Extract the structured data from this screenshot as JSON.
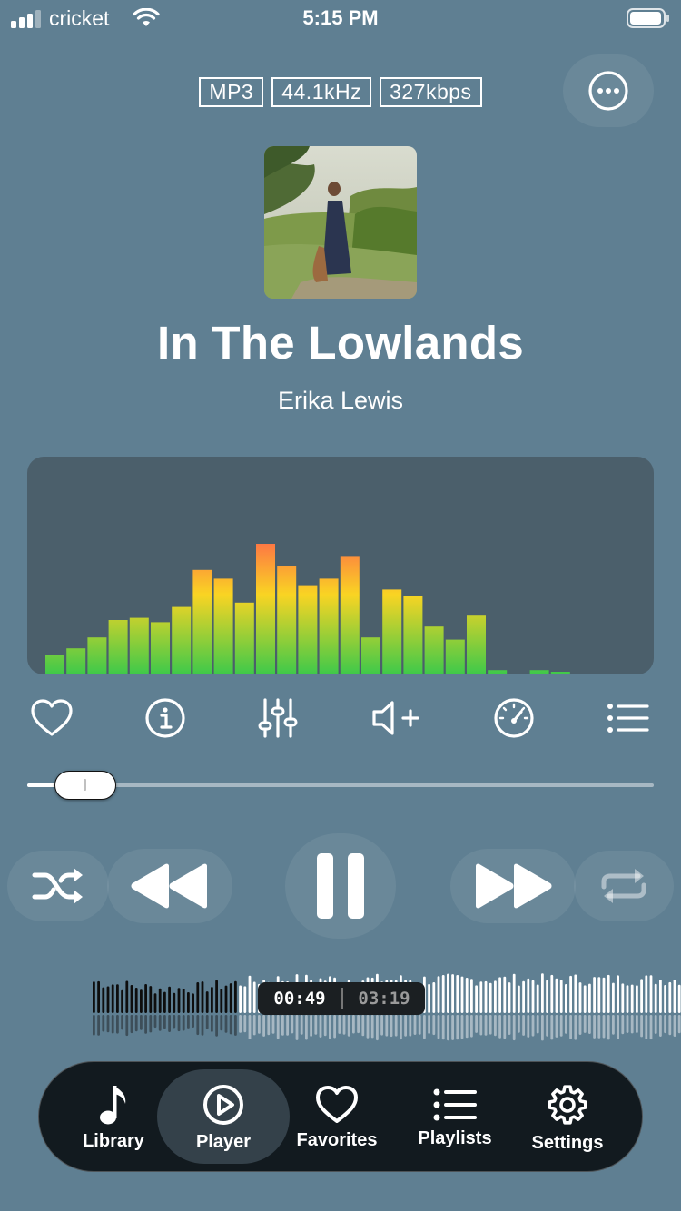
{
  "status_bar": {
    "carrier": "cricket",
    "time": "5:15 PM"
  },
  "format": {
    "codec": "MP3",
    "sample_rate": "44.1kHz",
    "bitrate": "327kbps"
  },
  "track": {
    "title": "In The Lowlands",
    "artist": "Erika Lewis"
  },
  "spectrum_levels": [
    0.09,
    0.12,
    0.17,
    0.25,
    0.26,
    0.24,
    0.31,
    0.48,
    0.44,
    0.33,
    0.6,
    0.5,
    0.41,
    0.44,
    0.54,
    0.17,
    0.39,
    0.36,
    0.22,
    0.16,
    0.27,
    0.02,
    0,
    0.02,
    0.01,
    0,
    0,
    0,
    0,
    0
  ],
  "actions": [
    "heart-icon",
    "info-icon",
    "equalizer-icon",
    "volume-boost-icon",
    "speed-gauge-icon",
    "queue-list-icon"
  ],
  "volume_level": 0.05,
  "playback": {
    "current_time": "00:49",
    "total_time": "03:19",
    "progress": 0.246
  },
  "tabs": [
    {
      "label": "Library",
      "icon": "music-note-icon"
    },
    {
      "label": "Player",
      "icon": "play-circle-icon",
      "active": true
    },
    {
      "label": "Favorites",
      "icon": "heart-icon"
    },
    {
      "label": "Playlists",
      "icon": "list-icon"
    },
    {
      "label": "Settings",
      "icon": "gear-icon"
    }
  ],
  "colors": {
    "background": "#5f7f92",
    "spectrum_panel": "#4b5f6b",
    "tab_bar": "#121a1f",
    "bar_low": "#3ec94a",
    "bar_mid": "#f9d423",
    "bar_high": "#ff5e4d"
  }
}
